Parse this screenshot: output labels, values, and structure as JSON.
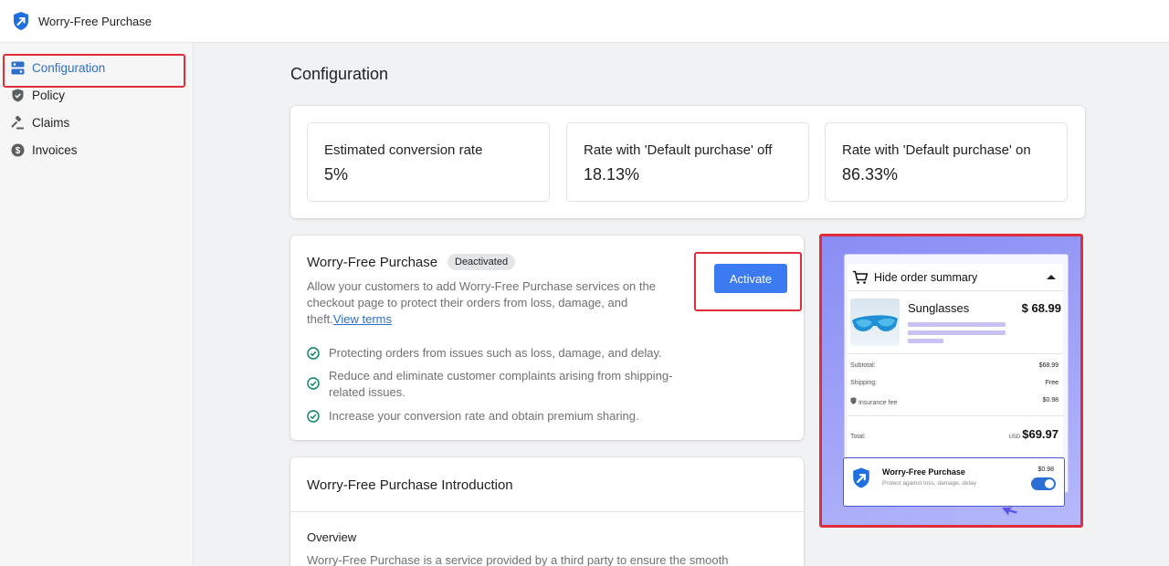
{
  "app": {
    "title": "Worry-Free Purchase",
    "logo_icon": "shield-arrow-icon"
  },
  "sidebar": {
    "items": [
      {
        "label": "Configuration",
        "icon": "configuration-icon",
        "active": true
      },
      {
        "label": "Policy",
        "icon": "shield-icon",
        "active": false
      },
      {
        "label": "Claims",
        "icon": "gavel-icon",
        "active": false
      },
      {
        "label": "Invoices",
        "icon": "dollar-circle-icon",
        "active": false
      }
    ]
  },
  "page": {
    "title": "Configuration"
  },
  "stats": [
    {
      "label": "Estimated conversion rate",
      "value": "5%"
    },
    {
      "label": "Rate with 'Default purchase' off",
      "value": "18.13%"
    },
    {
      "label": "Rate with 'Default purchase' on",
      "value": "86.33%"
    }
  ],
  "wfp_card": {
    "title": "Worry-Free Purchase",
    "status": "Deactivated",
    "description": "Allow your customers to add Worry-Free Purchase services on the checkout page to protect their orders from loss, damage, and theft.",
    "view_terms": "View terms",
    "activate_label": "Activate",
    "benefits": [
      "Protecting orders from issues such as loss, damage, and delay.",
      "Reduce and eliminate customer complaints arising from shipping-related issues.",
      "Increase your conversion rate and obtain premium sharing."
    ]
  },
  "intro_card": {
    "title": "Worry-Free Purchase Introduction",
    "overview_label": "Overview",
    "overview_text": "Worry-Free Purchase is a service provided by a third party to ensure the smooth"
  },
  "preview": {
    "summary_toggle": "Hide order summary",
    "product_name": "Sunglasses",
    "product_price": "$ 68.99",
    "subtotal_label": "Subtotal:",
    "subtotal_value": "$68.99",
    "shipping_label": "Shipping:",
    "shipping_value": "Free",
    "insurance_label": "Insurance fee",
    "insurance_value": "$0.98",
    "total_label": "Total:",
    "total_currency": "USD",
    "total_value": "$69.97",
    "wfp_name": "Worry-Free Purchase",
    "wfp_subtitle": "Protect against loss, damage, delay",
    "wfp_price": "$0.98",
    "wfp_toggle_on": true
  },
  "colors": {
    "accent": "#3b7af0",
    "active_nav": "#2c6ecb",
    "highlight_border": "#e02d3c",
    "preview_bg": "#8a8cf4",
    "check_green": "#008060"
  }
}
